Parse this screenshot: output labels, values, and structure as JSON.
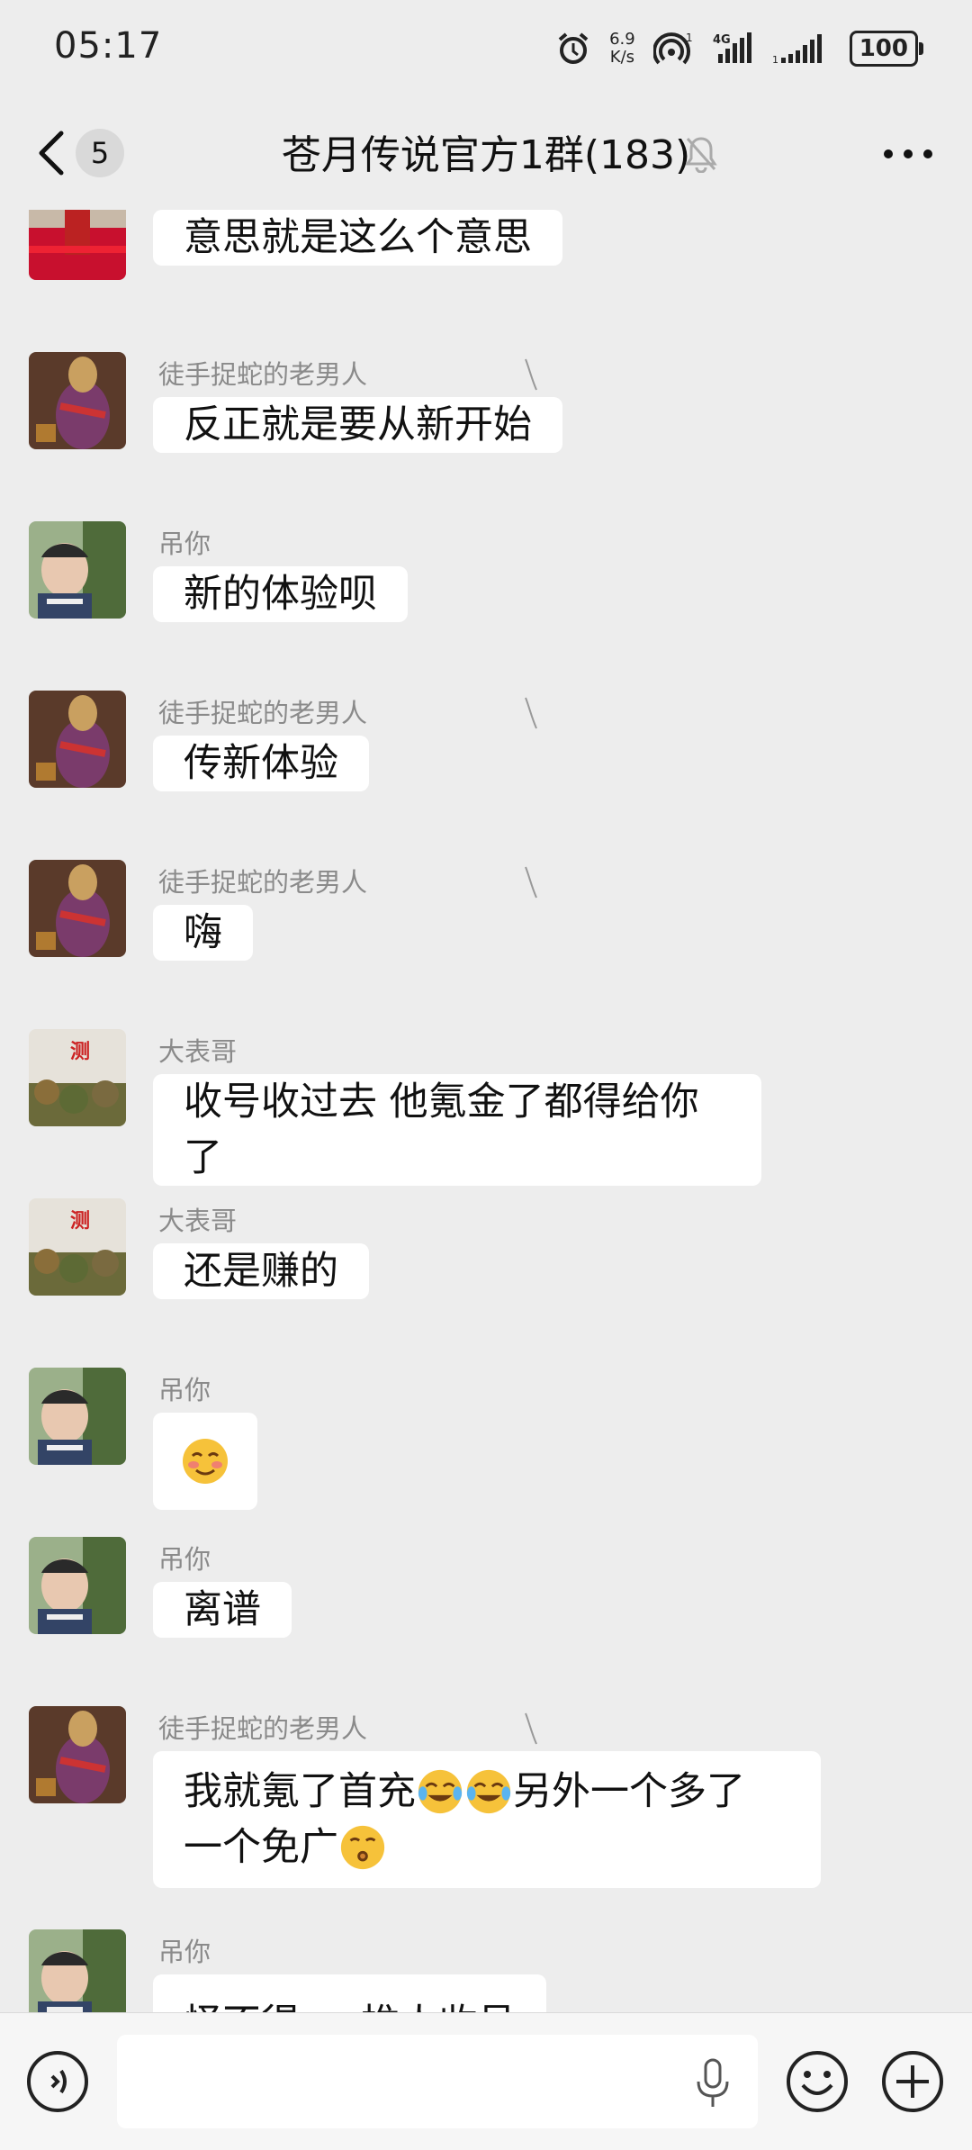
{
  "status_bar": {
    "time": "05:17",
    "net_speed_value": "6.9",
    "net_speed_unit": "K/s",
    "battery": "100"
  },
  "header": {
    "back_count": "5",
    "title": "苍月传说官方1群(183)"
  },
  "messages": [
    {
      "sender": "",
      "text": "意思就是这么个意思",
      "avatar": "red-stage-avatar"
    },
    {
      "sender": "徒手捉蛇的老男人",
      "text": "反正就是要从新开始",
      "avatar": "ultraman-avatar"
    },
    {
      "sender": "吊你",
      "text": "新的体验呗",
      "avatar": "kid-avatar"
    },
    {
      "sender": "徒手捉蛇的老男人",
      "text": "传新体验",
      "avatar": "ultraman-avatar"
    },
    {
      "sender": "徒手捉蛇的老男人",
      "text": "嗨",
      "avatar": "ultraman-avatar"
    },
    {
      "sender": "大表哥",
      "text": "收号收过去 他氪金了都得给你了",
      "avatar": "plant-avatar"
    },
    {
      "sender": "大表哥",
      "text": "还是赚的",
      "avatar": "plant-avatar"
    },
    {
      "sender": "吊你",
      "text": "",
      "emoji": "blushing-smile-emoji",
      "avatar": "kid-avatar"
    },
    {
      "sender": "吊你",
      "text": "离谱",
      "avatar": "kid-avatar"
    },
    {
      "sender": "徒手捉蛇的老男人",
      "text_line1": "我就氪了首充",
      "text_line1b": "另外一个多了",
      "text_line2": "一个免广",
      "emoji_line1": "tears-of-joy-emoji",
      "emoji_line2": "whistle-emoji",
      "avatar": "ultraman-avatar"
    },
    {
      "sender": "吊你",
      "text": "怪不得 ... 推人收号",
      "avatar": "kid-avatar"
    }
  ],
  "input_bar": {
    "placeholder": ""
  },
  "colors": {
    "background": "#ededed",
    "bubble": "#ffffff",
    "sender": "#8a8a8a"
  }
}
